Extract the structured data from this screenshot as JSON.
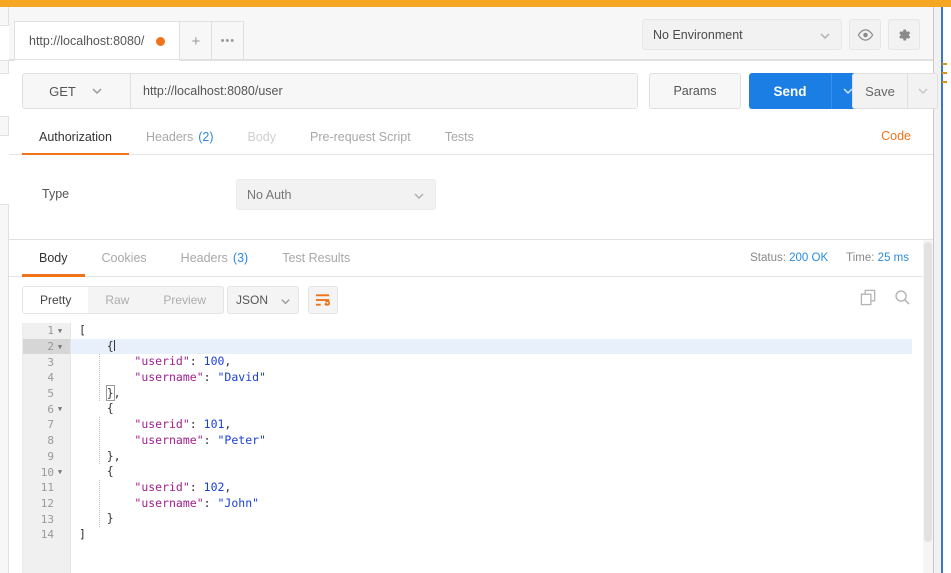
{
  "window": {
    "accent_orange": "#f5a623",
    "accent_blue": "#1a7ee5",
    "tab_underline": "#f0731a"
  },
  "tabbar": {
    "request_tab_title": "http://localhost:8080/",
    "unsaved_dot": "unsaved-dot",
    "new_tab_label": "+",
    "more_label": "•••",
    "environment": {
      "selected": "No Environment",
      "dropdown_icon": "chevron-down-icon",
      "eye_icon": "eye-icon",
      "gear_icon": "gear-icon"
    }
  },
  "request": {
    "method": "GET",
    "method_caret": "chevron-down-icon",
    "url": "http://localhost:8080/user",
    "params_label": "Params",
    "send_label": "Send",
    "send_caret": "chevron-down-icon",
    "save_label": "Save",
    "save_caret": "chevron-down-icon",
    "tabs": [
      {
        "label": "Authorization",
        "count": "",
        "state": "active"
      },
      {
        "label": "Headers",
        "count": "(2)",
        "state": "normal"
      },
      {
        "label": "Body",
        "count": "",
        "state": "disabled"
      },
      {
        "label": "Pre-request Script",
        "count": "",
        "state": "normal"
      },
      {
        "label": "Tests",
        "count": "",
        "state": "normal"
      }
    ],
    "code_link": "Code"
  },
  "authorization": {
    "type_label": "Type",
    "type_value": "No Auth",
    "type_caret": "chevron-down-icon"
  },
  "response": {
    "tabs": [
      {
        "label": "Body",
        "count": "",
        "state": "active"
      },
      {
        "label": "Cookies",
        "count": "",
        "state": "normal"
      },
      {
        "label": "Headers",
        "count": "(3)",
        "state": "normal"
      },
      {
        "label": "Test Results",
        "count": "",
        "state": "normal"
      }
    ],
    "status_label": "Status:",
    "status_value": "200 OK",
    "time_label": "Time:",
    "time_value": "25 ms",
    "view_modes": [
      {
        "label": "Pretty",
        "state": "on"
      },
      {
        "label": "Raw",
        "state": "off"
      },
      {
        "label": "Preview",
        "state": "off"
      }
    ],
    "format": "JSON",
    "format_caret": "chevron-down-icon",
    "beautify_icon": "wrap-lines-icon",
    "copy_icon": "copy-icon",
    "search_icon": "search-icon",
    "body_lines": [
      {
        "num": "1",
        "fold": "▼",
        "hl": false,
        "indent": 0,
        "tokens": [
          {
            "t": "[",
            "c": "p"
          }
        ]
      },
      {
        "num": "2",
        "fold": "▼",
        "hl": true,
        "indent": 1,
        "tokens": [
          {
            "t": "{",
            "c": "p"
          },
          {
            "t": "|",
            "c": "caret"
          }
        ]
      },
      {
        "num": "3",
        "fold": "",
        "hl": false,
        "indent": 2,
        "tokens": [
          {
            "t": "\"userid\"",
            "c": "k"
          },
          {
            "t": ": ",
            "c": "p"
          },
          {
            "t": "100",
            "c": "n"
          },
          {
            "t": ",",
            "c": "p"
          }
        ]
      },
      {
        "num": "4",
        "fold": "",
        "hl": false,
        "indent": 2,
        "tokens": [
          {
            "t": "\"username\"",
            "c": "k"
          },
          {
            "t": ": ",
            "c": "p"
          },
          {
            "t": "\"David\"",
            "c": "s"
          }
        ]
      },
      {
        "num": "5",
        "fold": "",
        "hl": false,
        "indent": 1,
        "tokens": [
          {
            "t": "}",
            "c": "box"
          },
          {
            "t": ",",
            "c": "p"
          }
        ]
      },
      {
        "num": "6",
        "fold": "▼",
        "hl": false,
        "indent": 1,
        "tokens": [
          {
            "t": "{",
            "c": "p"
          }
        ]
      },
      {
        "num": "7",
        "fold": "",
        "hl": false,
        "indent": 2,
        "tokens": [
          {
            "t": "\"userid\"",
            "c": "k"
          },
          {
            "t": ": ",
            "c": "p"
          },
          {
            "t": "101",
            "c": "n"
          },
          {
            "t": ",",
            "c": "p"
          }
        ]
      },
      {
        "num": "8",
        "fold": "",
        "hl": false,
        "indent": 2,
        "tokens": [
          {
            "t": "\"username\"",
            "c": "k"
          },
          {
            "t": ": ",
            "c": "p"
          },
          {
            "t": "\"Peter\"",
            "c": "s"
          }
        ]
      },
      {
        "num": "9",
        "fold": "",
        "hl": false,
        "indent": 1,
        "tokens": [
          {
            "t": "}",
            "c": "p"
          },
          {
            "t": ",",
            "c": "p"
          }
        ]
      },
      {
        "num": "10",
        "fold": "▼",
        "hl": false,
        "indent": 1,
        "tokens": [
          {
            "t": "{",
            "c": "p"
          }
        ]
      },
      {
        "num": "11",
        "fold": "",
        "hl": false,
        "indent": 2,
        "tokens": [
          {
            "t": "\"userid\"",
            "c": "k"
          },
          {
            "t": ": ",
            "c": "p"
          },
          {
            "t": "102",
            "c": "n"
          },
          {
            "t": ",",
            "c": "p"
          }
        ]
      },
      {
        "num": "12",
        "fold": "",
        "hl": false,
        "indent": 2,
        "tokens": [
          {
            "t": "\"username\"",
            "c": "k"
          },
          {
            "t": ": ",
            "c": "p"
          },
          {
            "t": "\"John\"",
            "c": "s"
          }
        ]
      },
      {
        "num": "13",
        "fold": "",
        "hl": false,
        "indent": 1,
        "tokens": [
          {
            "t": "}",
            "c": "p"
          }
        ]
      },
      {
        "num": "14",
        "fold": "",
        "hl": false,
        "indent": 0,
        "tokens": [
          {
            "t": "]",
            "c": "p"
          }
        ]
      }
    ]
  }
}
